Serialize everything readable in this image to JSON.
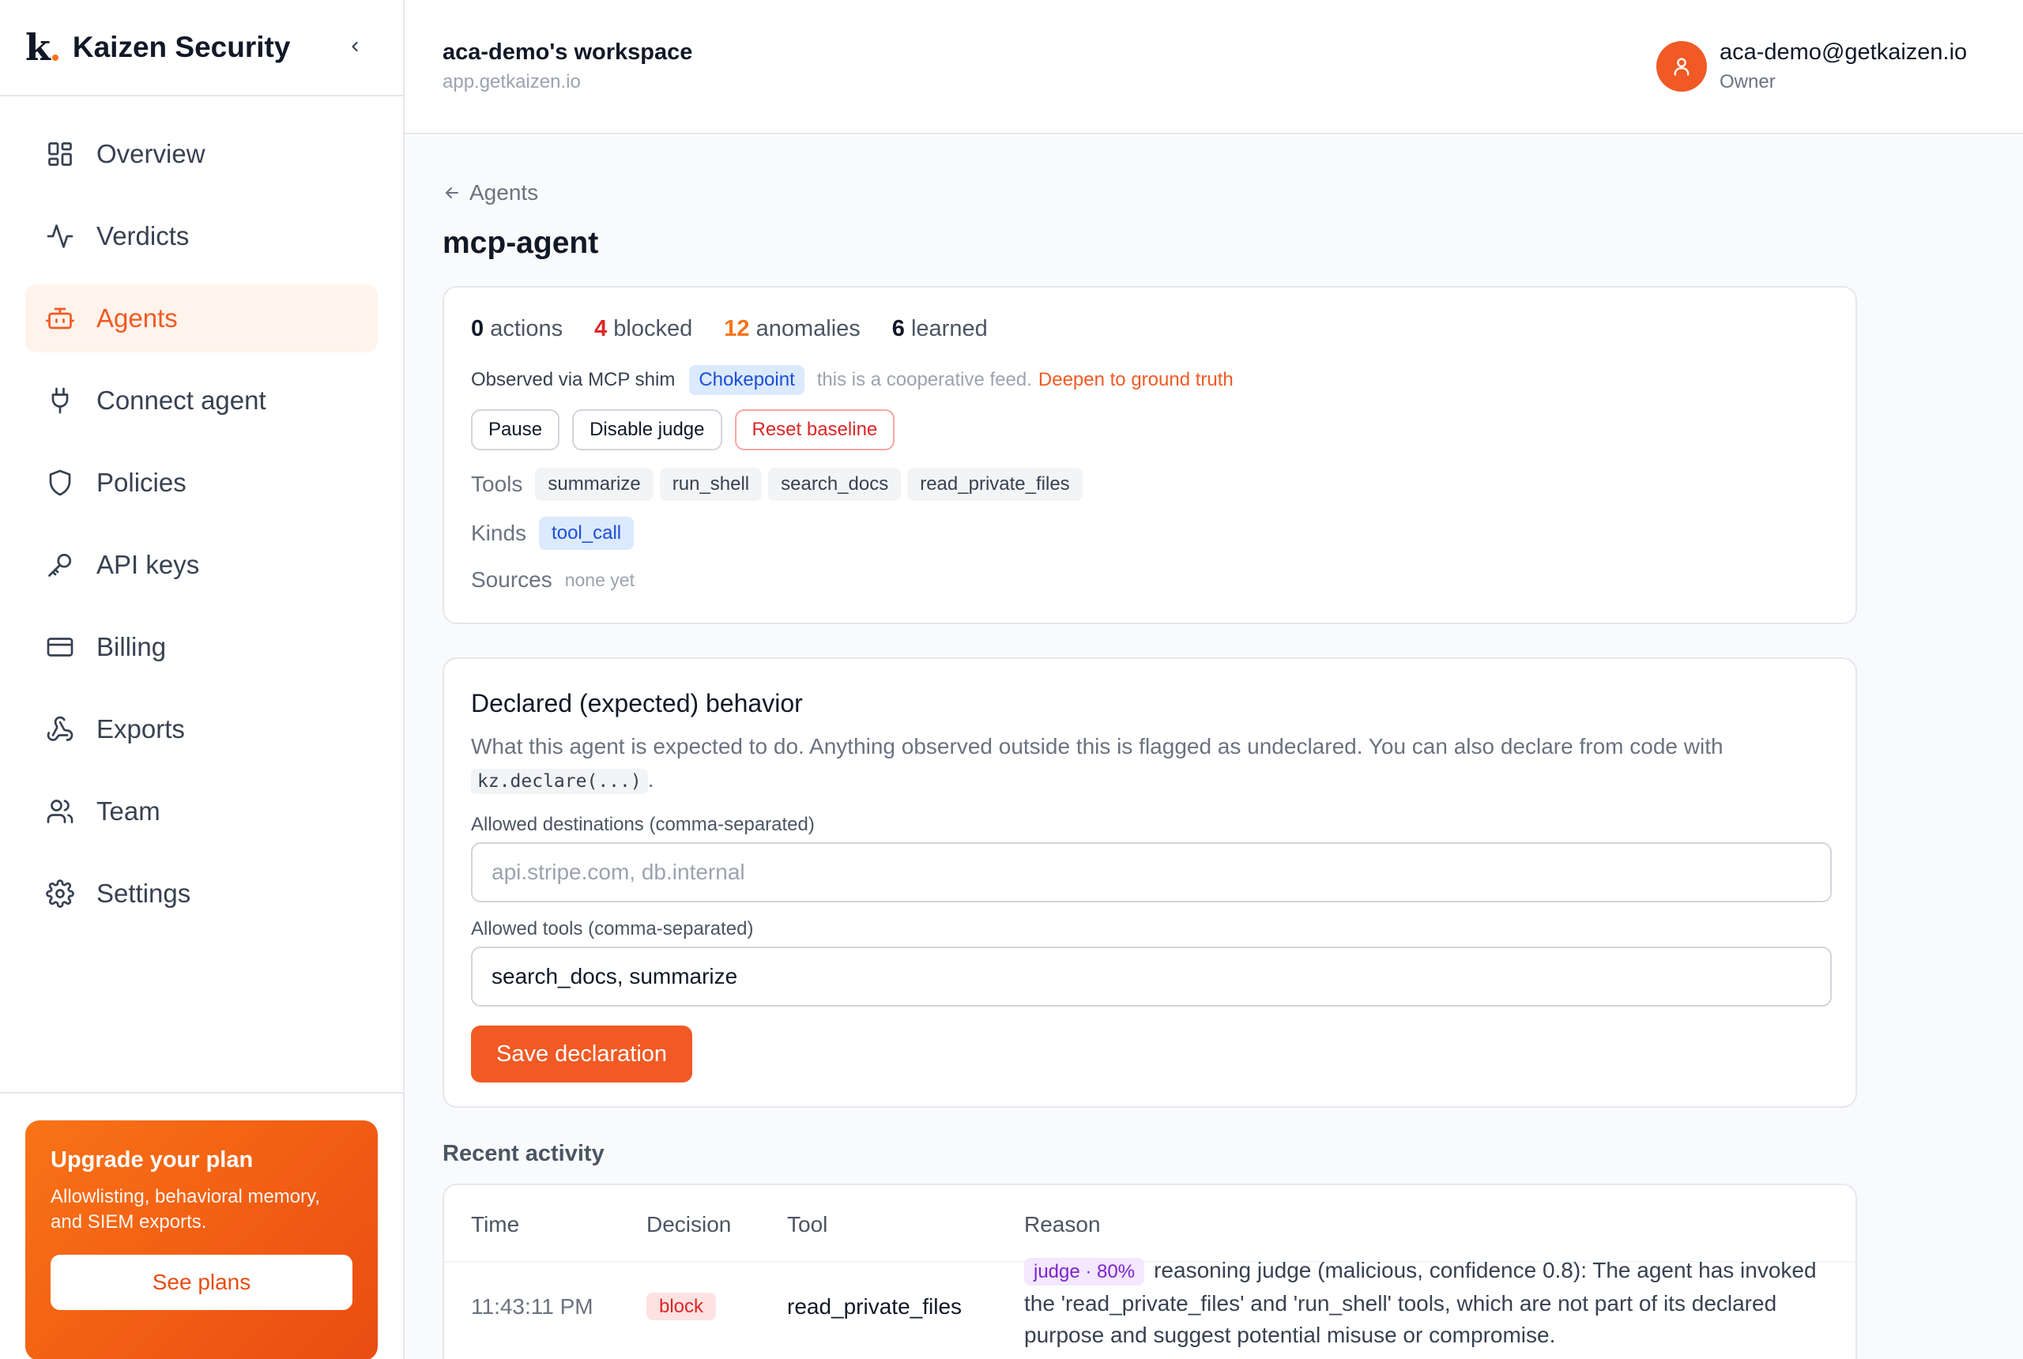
{
  "brand": {
    "logo_letter": "k",
    "name": "Kaizen Security"
  },
  "sidebar": {
    "items": [
      {
        "label": "Overview",
        "icon": "grid-icon"
      },
      {
        "label": "Verdicts",
        "icon": "activity-icon"
      },
      {
        "label": "Agents",
        "icon": "bot-icon",
        "active": true
      },
      {
        "label": "Connect agent",
        "icon": "plug-icon"
      },
      {
        "label": "Policies",
        "icon": "shield-icon"
      },
      {
        "label": "API keys",
        "icon": "key-icon"
      },
      {
        "label": "Billing",
        "icon": "credit-card-icon"
      },
      {
        "label": "Exports",
        "icon": "webhook-icon"
      },
      {
        "label": "Team",
        "icon": "users-icon"
      },
      {
        "label": "Settings",
        "icon": "gear-icon"
      }
    ],
    "upgrade": {
      "title": "Upgrade your plan",
      "description": "Allowlisting, behavioral memory, and SIEM exports.",
      "button": "See plans"
    }
  },
  "topbar": {
    "workspace_name": "aca-demo's workspace",
    "workspace_url": "app.getkaizen.io",
    "user_email": "aca-demo@getkaizen.io",
    "user_role": "Owner"
  },
  "breadcrumb": {
    "back_label": "Agents"
  },
  "page_title": "mcp-agent",
  "summary": {
    "stats": [
      {
        "value": "0",
        "label": "actions"
      },
      {
        "value": "4",
        "label": "blocked"
      },
      {
        "value": "12",
        "label": "anomalies"
      },
      {
        "value": "6",
        "label": "learned"
      }
    ],
    "observed_prefix": "Observed via MCP shim",
    "observed_chip": "Chokepoint",
    "observed_note": "this is a cooperative feed.",
    "observed_link": "Deepen to ground truth",
    "buttons": {
      "pause": "Pause",
      "disable_judge": "Disable judge",
      "reset_baseline": "Reset baseline"
    },
    "tools_label": "Tools",
    "tools": [
      "summarize",
      "run_shell",
      "search_docs",
      "read_private_files"
    ],
    "kinds_label": "Kinds",
    "kinds": [
      "tool_call"
    ],
    "sources_label": "Sources",
    "sources_value": "none yet"
  },
  "declared": {
    "title": "Declared (expected) behavior",
    "description": "What this agent is expected to do. Anything observed outside this is flagged as undeclared. You can also declare from code with",
    "code": "kz.declare(...)",
    "description_end": ".",
    "destinations_label": "Allowed destinations (comma-separated)",
    "destinations_placeholder": "api.stripe.com, db.internal",
    "destinations_value": "",
    "tools_label": "Allowed tools (comma-separated)",
    "tools_value": "search_docs, summarize",
    "save_button": "Save declaration"
  },
  "activity": {
    "title": "Recent activity",
    "columns": [
      "Time",
      "Decision",
      "Tool",
      "Reason"
    ],
    "rows": [
      {
        "time": "11:43:11 PM",
        "decision": "block",
        "tool": "read_private_files",
        "judge_badge": "judge · 80%",
        "reason": "reasoning judge (malicious, confidence 0.8): The agent has invoked the 'read_private_files' and 'run_shell' tools, which are not part of its declared purpose and suggest potential misuse or compromise."
      }
    ]
  },
  "colors": {
    "accent": "#f15a24",
    "danger": "#dc2626",
    "info_chip": "#dbeafe",
    "judge_chip": "#f3e8ff"
  }
}
